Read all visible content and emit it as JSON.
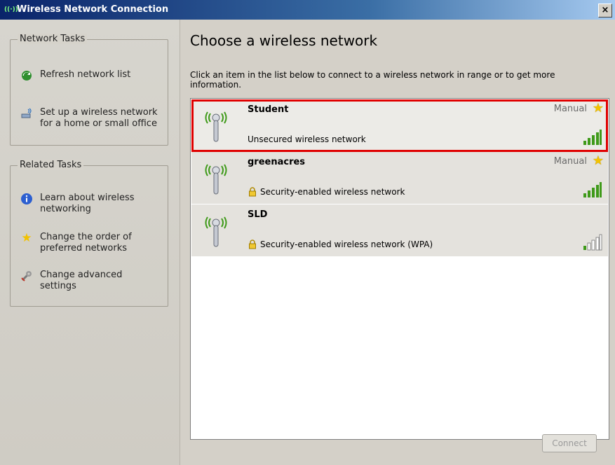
{
  "window": {
    "title": "Wireless Network Connection",
    "close_label": "×"
  },
  "sidebar": {
    "network_tasks": {
      "title": "Network Tasks",
      "items": [
        {
          "label": "Refresh network list",
          "icon": "refresh-icon"
        },
        {
          "label": "Set up a wireless network for a home or small office",
          "icon": "setup-network-icon"
        }
      ]
    },
    "related_tasks": {
      "title": "Related Tasks",
      "items": [
        {
          "label": "Learn about wireless networking",
          "icon": "info-icon"
        },
        {
          "label": "Change the order of preferred networks",
          "icon": "star-icon"
        },
        {
          "label": "Change advanced settings",
          "icon": "settings-icon"
        }
      ]
    }
  },
  "main": {
    "heading": "Choose a wireless network",
    "instructions": "Click an item in the list below to connect to a wireless network in range or to get more information.",
    "networks": [
      {
        "name": "Student",
        "security": "Unsecured wireless network",
        "status": "Manual",
        "preferred": true,
        "signal_bars": 5,
        "secured": false,
        "selected": true
      },
      {
        "name": "greenacres",
        "security": "Security-enabled wireless network",
        "status": "Manual",
        "preferred": true,
        "signal_bars": 5,
        "secured": true,
        "selected": false
      },
      {
        "name": "SLD",
        "security": "Security-enabled wireless network (WPA)",
        "status": "",
        "preferred": false,
        "signal_bars": 1,
        "secured": true,
        "selected": false
      }
    ],
    "connect_label": "Connect"
  },
  "colors": {
    "selection_outline": "#e00000",
    "signal_green": "#3f9a1a",
    "star": "#f2c200"
  }
}
